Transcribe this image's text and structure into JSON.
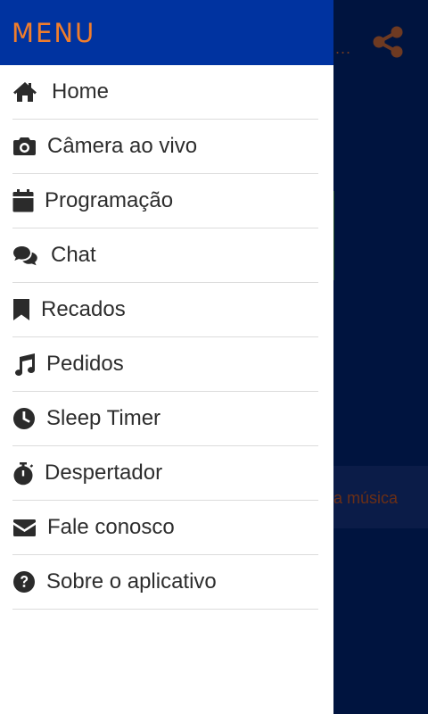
{
  "drawer": {
    "title": "MENU",
    "items": [
      {
        "icon": "home-icon",
        "label": "Home"
      },
      {
        "icon": "camera-icon",
        "label": "Câmera ao vivo"
      },
      {
        "icon": "calendar-icon",
        "label": "Programação"
      },
      {
        "icon": "chat-icon",
        "label": "Chat"
      },
      {
        "icon": "bookmark-icon",
        "label": "Recados"
      },
      {
        "icon": "music-note-icon",
        "label": "Pedidos"
      },
      {
        "icon": "clock-icon",
        "label": "Sleep Timer"
      },
      {
        "icon": "stopwatch-icon",
        "label": "Despertador"
      },
      {
        "icon": "envelope-icon",
        "label": "Fale conosco"
      },
      {
        "icon": "question-circle-icon",
        "label": "Sobre o aplicativo"
      }
    ]
  },
  "background": {
    "ellipsis": "...",
    "share_icon": "share-icon",
    "partial_text": "a música"
  },
  "colors": {
    "header_bg": "#0033a0",
    "title_accent": "#f07d2c",
    "page_bg": "#00143f",
    "icon": "#2b2b2b"
  }
}
